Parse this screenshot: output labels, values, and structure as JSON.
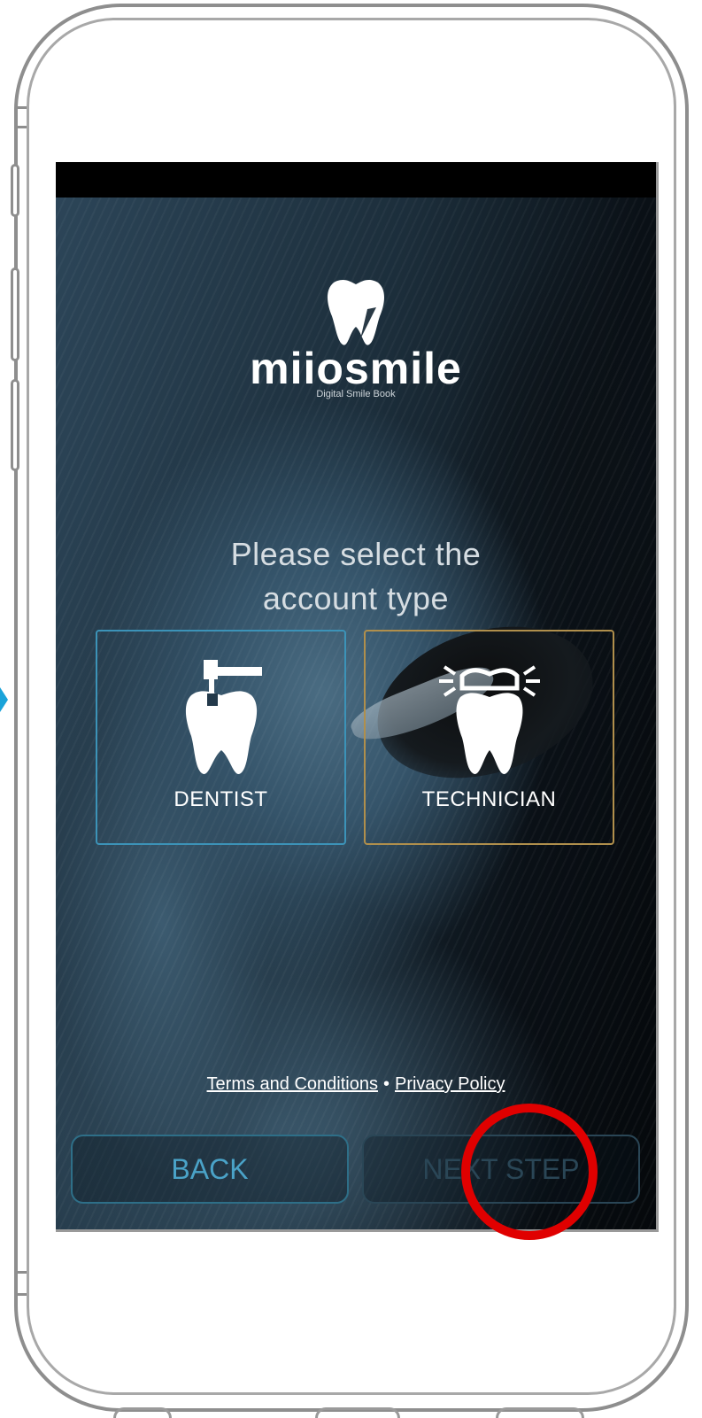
{
  "app": {
    "logo_text": "miiosmile",
    "logo_tagline": "Digital Smile Book"
  },
  "screen": {
    "prompt_line1": "Please select the",
    "prompt_line2": "account type",
    "account_types": [
      {
        "label": "DENTIST",
        "icon": "tooth-drill-icon",
        "border_color": "#3c93b8"
      },
      {
        "label": "TECHNICIAN",
        "icon": "tooth-crown-icon",
        "border_color": "#b08f4c"
      }
    ],
    "legal": {
      "terms_label": "Terms and Conditions",
      "separator": "•",
      "privacy_label": "Privacy Policy"
    },
    "buttons": {
      "back_label": "BACK",
      "next_label": "NEXT STEP"
    }
  },
  "annotation": {
    "highlight_color": "#e00000",
    "highlight_target": "next-step-button"
  }
}
